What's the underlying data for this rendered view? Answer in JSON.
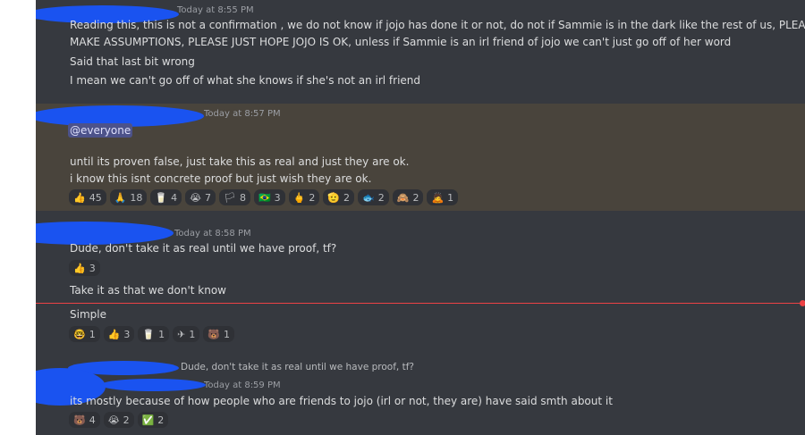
{
  "messages": [
    {
      "timestamp": "Today at 8:55 PM",
      "lines": [
        "Reading this, this is not a confirmation , we do not know if jojo has done it or not, do not if Sammie is in the dark like the rest of us, PLEASE DO NOT",
        "MAKE ASSUMPTIONS, PLEASE JUST HOPE JOJO IS OK, unless if Sammie is an irl friend of jojo we can't just go off of her word",
        "Said that last bit wrong",
        "I mean we can't go off of what she knows if she's not an irl friend"
      ]
    },
    {
      "timestamp": "Today at 8:57 PM",
      "mention": "@everyone",
      "lines": [
        "until its proven false, just take this as real and just they are ok.",
        "i know this isnt concrete proof but just wish they are ok."
      ],
      "reactions": [
        {
          "emoji": "👍",
          "count": "45"
        },
        {
          "emoji": "🙏",
          "count": "18"
        },
        {
          "emoji": "🥛",
          "count": "4"
        },
        {
          "emoji": "😭",
          "count": "7"
        },
        {
          "emoji": "🏳",
          "count": "8"
        },
        {
          "emoji": "🇧🇷",
          "count": "3"
        },
        {
          "emoji": "🖕",
          "count": "2"
        },
        {
          "emoji": "🫡",
          "count": "2"
        },
        {
          "emoji": "🐟",
          "count": "2"
        },
        {
          "emoji": "🙈",
          "count": "2"
        },
        {
          "emoji": "🙇",
          "count": "1"
        }
      ]
    },
    {
      "timestamp": "Today at 8:58 PM",
      "lines": [
        "Dude, don't take it as real until we have proof, tf?"
      ],
      "reactions": [
        {
          "emoji": "👍",
          "count": "3"
        }
      ],
      "follow": [
        "Take it as that we don't know",
        "Simple"
      ],
      "follow_reactions": [
        {
          "emoji": "🤓",
          "count": "1"
        },
        {
          "emoji": "👍",
          "count": "3"
        },
        {
          "emoji": "🥛",
          "count": "1"
        },
        {
          "emoji": "✈",
          "count": "1"
        },
        {
          "emoji": "🐻",
          "count": "1"
        }
      ]
    },
    {
      "reply_to": "Dude, don't take it as real until we have proof, tf?",
      "timestamp": "Today at 8:59 PM",
      "lines": [
        "its mostly because of how people who are friends to jojo (irl or not, they are) have said smth about it"
      ],
      "reactions": [
        {
          "emoji": "🐻",
          "count": "4"
        },
        {
          "emoji": "😭",
          "count": "2"
        },
        {
          "emoji": "✅",
          "count": "2"
        }
      ]
    }
  ]
}
